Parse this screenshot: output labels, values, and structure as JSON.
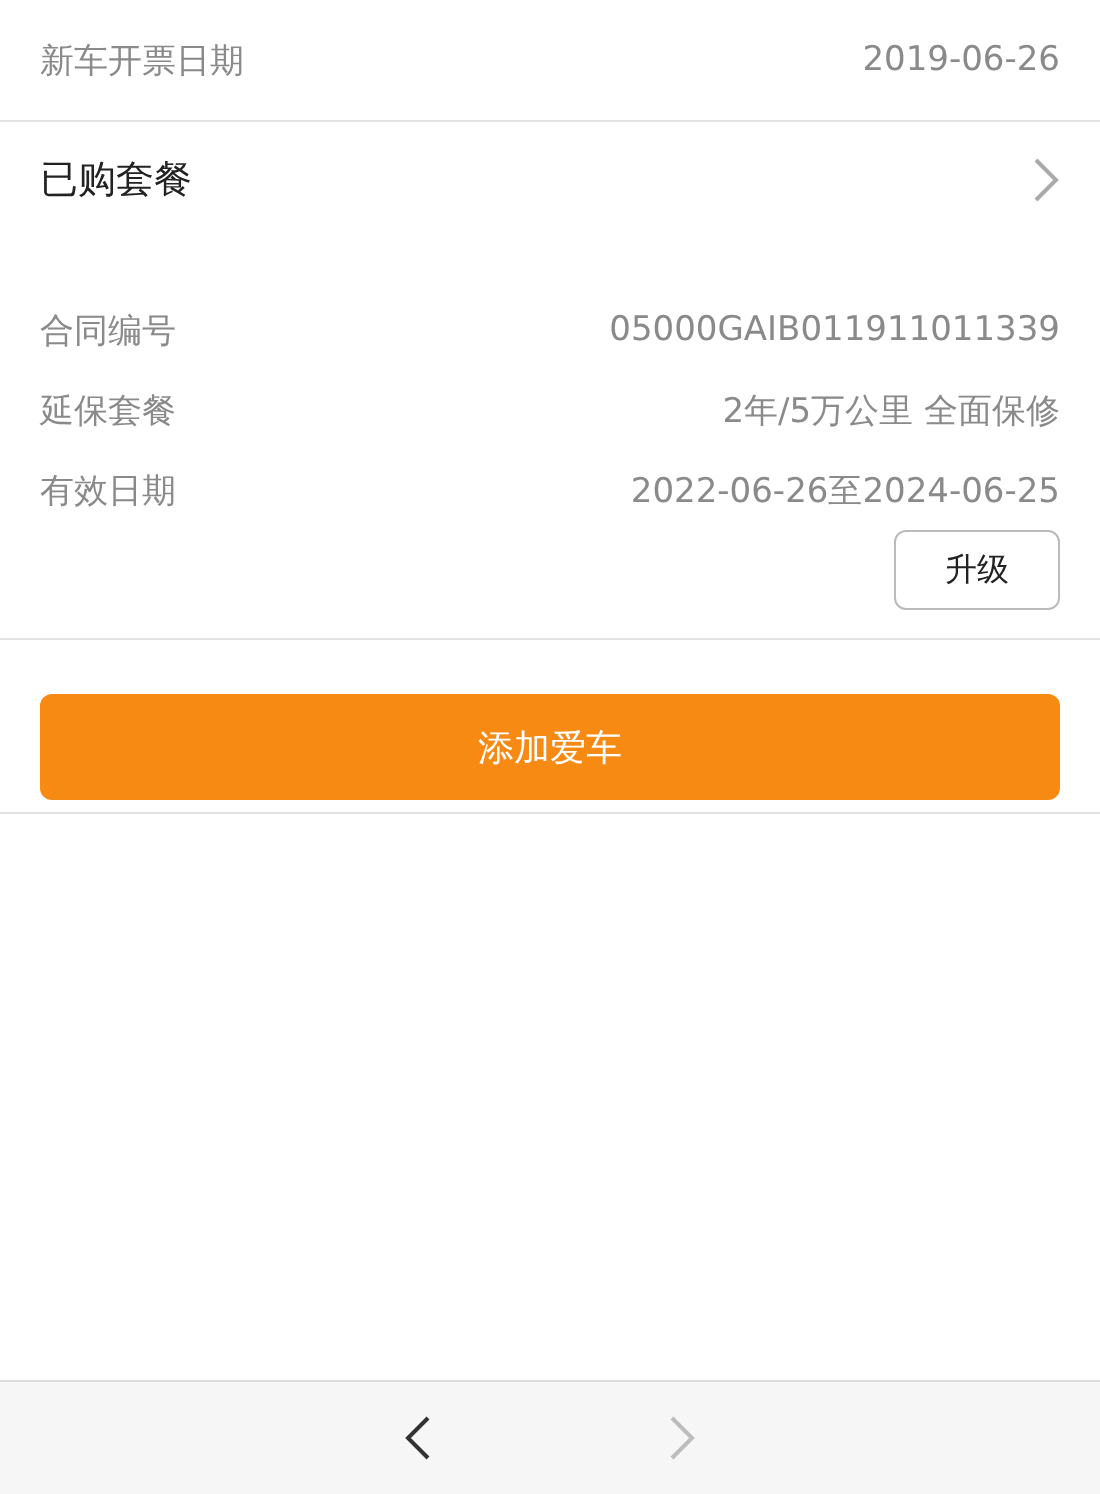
{
  "invoice_row": {
    "label": "新车开票日期",
    "value": "2019-06-26"
  },
  "package_header": {
    "title": "已购套餐"
  },
  "package_details": [
    {
      "label": "合同编号",
      "value": "05000GAIB011911011339"
    },
    {
      "label": "延保套餐",
      "value": "2年/5万公里 全面保修"
    },
    {
      "label": "有效日期",
      "value": "2022-06-26至2024-06-25"
    }
  ],
  "upgrade_button": "升级",
  "add_car_button": "添加爱车",
  "toolbar": [
    {
      "kind": "back",
      "disabled": false
    },
    {
      "kind": "forward",
      "disabled": true
    }
  ]
}
